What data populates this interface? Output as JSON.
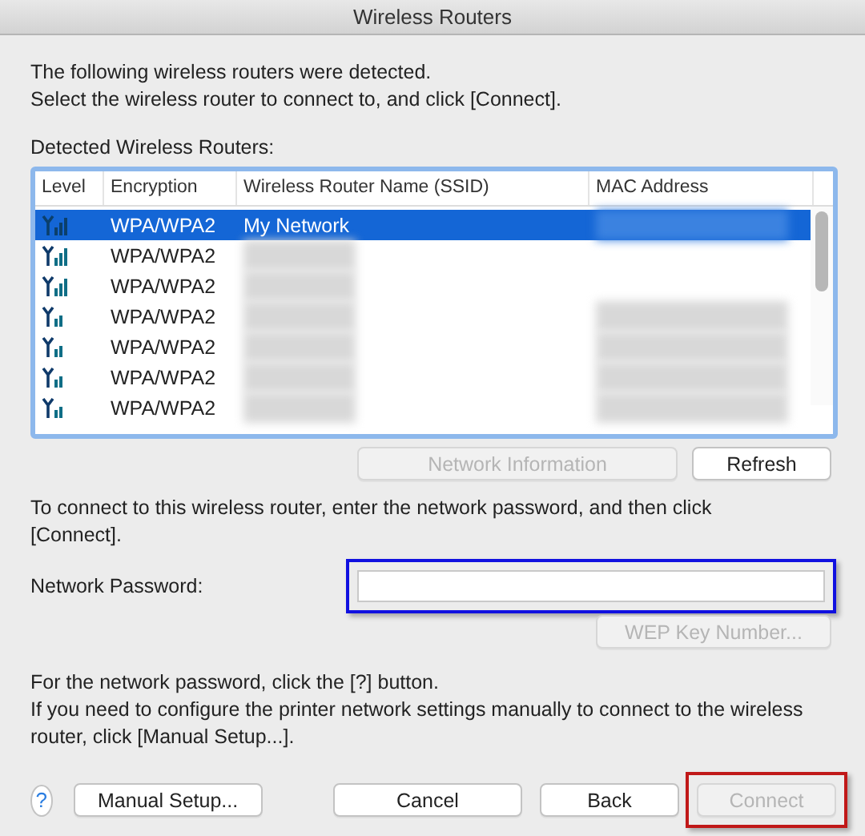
{
  "window": {
    "title": "Wireless Routers"
  },
  "intro": [
    "The following wireless routers were detected.",
    "Select the wireless router to connect to, and click [Connect]."
  ],
  "list_label": "Detected Wireless Routers:",
  "table": {
    "columns": [
      "Level",
      "Encryption",
      "Wireless Router Name (SSID)",
      "MAC Address"
    ],
    "rows": [
      {
        "kind": "strong",
        "encryption": "WPA/WPA2",
        "ssid": "My Network",
        "ssid_redacted": false,
        "mac_redacted": true,
        "selected": true
      },
      {
        "kind": "strong",
        "encryption": "WPA/WPA2",
        "ssid_redacted": true,
        "mac_redacted": false,
        "selected": false
      },
      {
        "kind": "strong",
        "encryption": "WPA/WPA2",
        "ssid_redacted": true,
        "mac_redacted": false,
        "selected": false
      },
      {
        "kind": "weak",
        "encryption": "WPA/WPA2",
        "ssid_redacted": true,
        "mac_redacted": true,
        "selected": false
      },
      {
        "kind": "weak",
        "encryption": "WPA/WPA2",
        "ssid_redacted": true,
        "mac_redacted": true,
        "selected": false
      },
      {
        "kind": "weak",
        "encryption": "WPA/WPA2",
        "ssid_redacted": true,
        "mac_redacted": true,
        "selected": false
      },
      {
        "kind": "weak",
        "encryption": "WPA/WPA2",
        "ssid_redacted": true,
        "mac_redacted": true,
        "selected": false
      }
    ]
  },
  "table_buttons": [
    {
      "label": "Network Information",
      "disabled": true
    },
    {
      "label": "Refresh",
      "disabled": false
    }
  ],
  "connect_hint": "To connect to this wireless router, enter the network password, and then click [Connect].",
  "password": {
    "label": "Network Password:",
    "highlighted": true
  },
  "wep_button": {
    "label": "WEP Key Number...",
    "disabled": true
  },
  "notes": [
    "For the network password, click the [?] button.",
    "If you need to configure the printer network settings manually to connect to the wireless router, click [Manual Setup...]."
  ],
  "help_button": "?",
  "buttons": [
    {
      "label": "Manual Setup...",
      "disabled": false,
      "highlighted": false
    },
    {
      "label": "Cancel",
      "disabled": false,
      "highlighted": false
    },
    {
      "label": "Back",
      "disabled": false,
      "highlighted": false
    },
    {
      "label": "Connect",
      "disabled": true,
      "highlighted": true
    }
  ]
}
